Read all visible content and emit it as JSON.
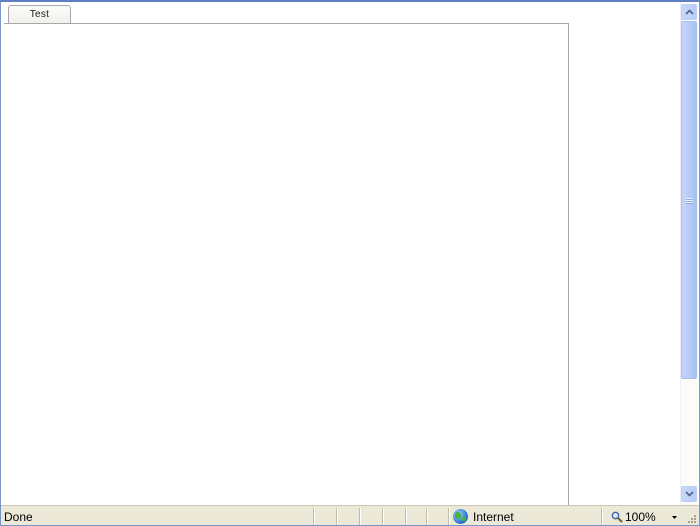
{
  "tab": {
    "label": "Test"
  },
  "statusbar": {
    "status": "Done",
    "zone": "Internet",
    "zoom": "100%"
  },
  "icons": {
    "zone": "globe-icon",
    "zoom": "magnifier-icon",
    "zoom_menu": "chevron-down-icon",
    "scroll_up": "chevron-up-icon",
    "scroll_down": "chevron-down-icon"
  }
}
